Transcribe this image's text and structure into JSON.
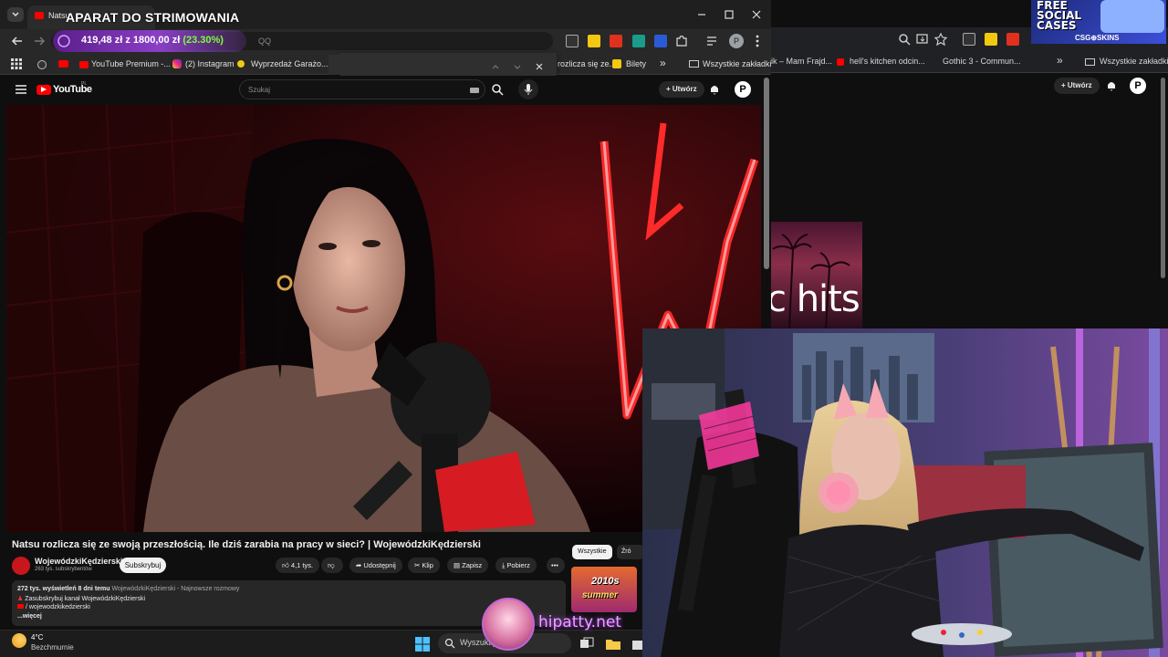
{
  "overlay": {
    "stream_title": "APARAT DO STRIMOWANIA",
    "donation_current": "419,48 zł",
    "donation_separator": "z",
    "donation_goal": "1800,00 zł",
    "donation_percent": "(23.30%)",
    "donation_progress": 0.233,
    "brand_text": "hipatty.net"
  },
  "browser": {
    "tab_title": "Natsu",
    "address_tail": "QQ",
    "bookmarks": [
      "YouTube Premium -...",
      "(2) Instagram",
      "Wyprzedaż Garażo...",
      "rozlicza się ze...",
      "Bilety"
    ],
    "all_bookmarks": "Wszystkie zakładki",
    "overflow": "»"
  },
  "youtube": {
    "logo": "YouTube",
    "logo_region": "PL",
    "search_placeholder": "Szukaj",
    "create_label": "Utwórz",
    "profile_initial": "P",
    "video_title": "Natsu rozlicza się ze swoją przeszłością. Ile dziś zarabia na pracy w sieci? | WojewódzkiKędzierski",
    "channel_name": "WojewódzkiKędzierski",
    "channel_subs": "263 tys. subskrybentów",
    "subscribe_label": "Subskrybuj",
    "likes": "4,1 tys.",
    "share_label": "Udostępnij",
    "clip_label": "Klip",
    "save_label": "Zapisz",
    "download_label": "Pobierz",
    "desc_stats": "272 tys. wyświetleń  8 dni temu",
    "desc_channel_hashtag": "WojewódzkiKędzierski - Najnowsze rozmowy",
    "desc_line2": "Zasubskrybuj kanał WojewódzkiKędzierski",
    "desc_line3": "/ wojewodzkikedzierski",
    "desc_more": "...więcej",
    "chip_all": "Wszystkie",
    "chip_source": "Źró",
    "rec_thumb_text": "2010s",
    "rec_thumb_text2": "summer"
  },
  "background_window": {
    "bookmarks": [
      "ik – Mam Frajd...",
      "hell's kitchen odcin...",
      "Gothic 3 - Commun..."
    ],
    "overflow": "»",
    "all_bookmarks": "Wszystkie zakładki",
    "create_label": "Utwórz",
    "profile_initial": "P",
    "thumb_text": "c hits"
  },
  "sponsor": {
    "line1": "FREE",
    "line2": "SOCIAL",
    "line3": "CASES",
    "brand": "CSG⊕SKINS"
  },
  "taskbar": {
    "temperature": "4°C",
    "weather": "Bezchmurnie",
    "search_placeholder": "Wyszukaj"
  },
  "colors": {
    "yt_red": "#ff0000",
    "donation_green": "#7dff3a",
    "accent_purple": "#8b3fc7",
    "neon_red": "#ff2a2a"
  }
}
